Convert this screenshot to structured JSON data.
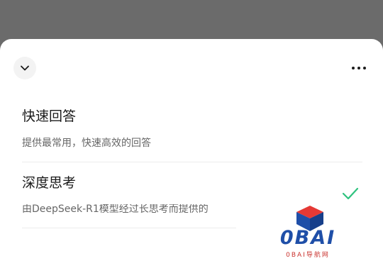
{
  "sheet": {
    "collapse_icon": "chevron-down-icon",
    "more_icon": "more-horizontal-icon"
  },
  "options": [
    {
      "title": "快速回答",
      "description": "提供最常用，快速高效的回答",
      "selected": false
    },
    {
      "title": "深度思考",
      "description": "由DeepSeek-R1模型经过长思考而提供的",
      "selected": true
    }
  ],
  "check_icon": "check-icon",
  "check_color": "#2ec27e",
  "watermark": {
    "logo": "0BAI",
    "subtitle": "0BAI导航网"
  }
}
